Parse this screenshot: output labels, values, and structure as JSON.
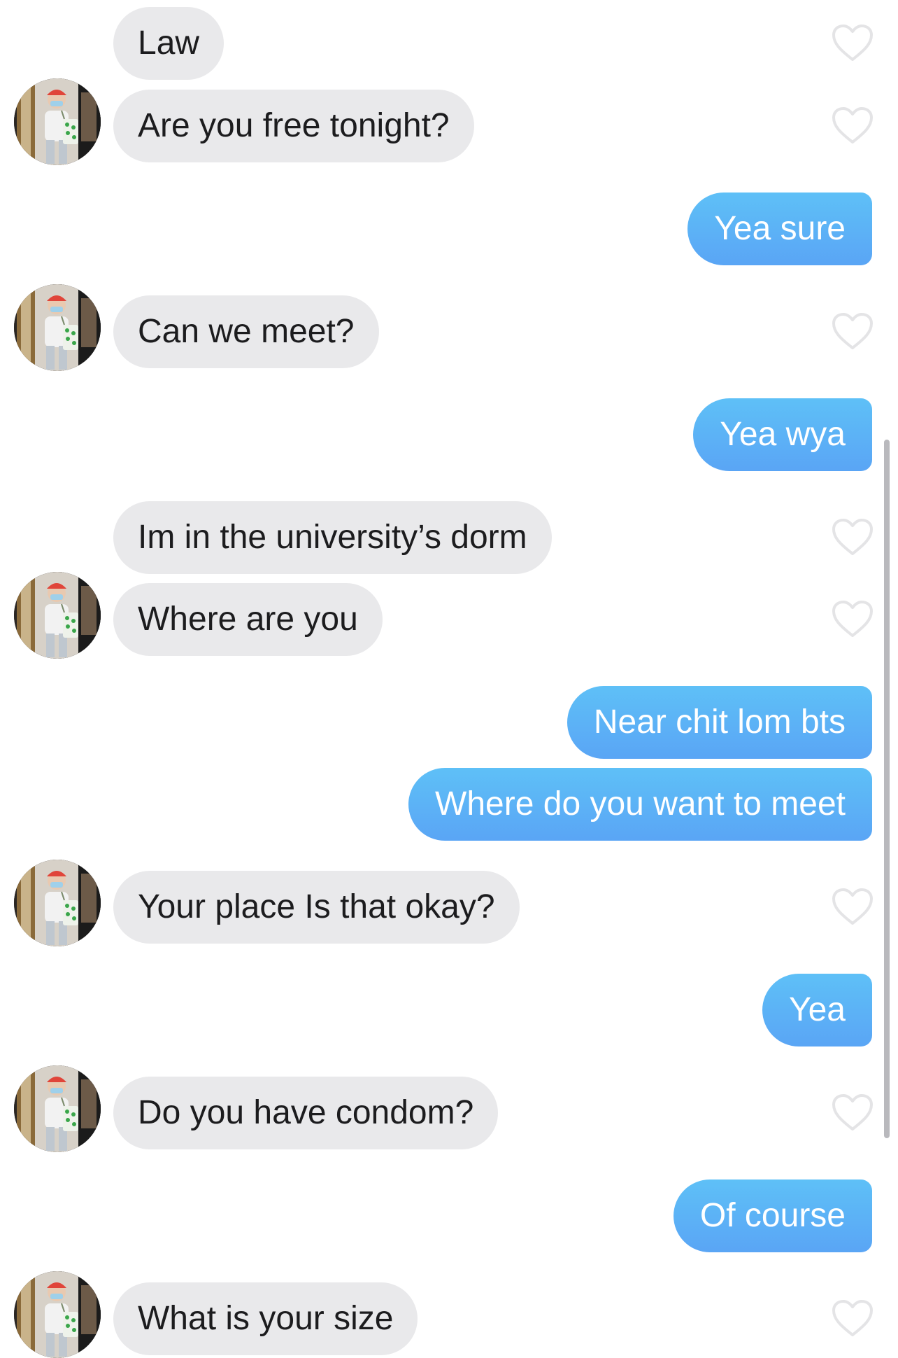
{
  "colors": {
    "incoming_bubble": "#e9e9eb",
    "outgoing_bubble_top": "#5ec0f7",
    "outgoing_bubble_bottom": "#5aa5f5",
    "heart_outline": "#e4e4e6"
  },
  "icons": {
    "like": "heart-outline-icon",
    "avatar": "contact-avatar-photo"
  },
  "messages": [
    {
      "side": "in",
      "text": "Law",
      "avatar": false,
      "liked": false
    },
    {
      "side": "in",
      "text": "Are you free tonight?",
      "avatar": true,
      "liked": false
    },
    {
      "side": "out",
      "text": "Yea sure"
    },
    {
      "side": "in",
      "text": "Can we meet?",
      "avatar": true,
      "liked": false
    },
    {
      "side": "out",
      "text": "Yea wya"
    },
    {
      "side": "in",
      "text": "Im in the university’s dorm",
      "avatar": false,
      "liked": false
    },
    {
      "side": "in",
      "text": "Where are you",
      "avatar": true,
      "liked": false
    },
    {
      "side": "out",
      "text": "Near chit lom bts"
    },
    {
      "side": "out",
      "text": "Where do you want to meet"
    },
    {
      "side": "in",
      "text": "Your place Is that okay?",
      "avatar": true,
      "liked": false
    },
    {
      "side": "out",
      "text": "Yea"
    },
    {
      "side": "in",
      "text": "Do you have condom?",
      "avatar": true,
      "liked": false
    },
    {
      "side": "out",
      "text": "Of course"
    },
    {
      "side": "in",
      "text": "What is your size",
      "avatar": true,
      "liked": false
    }
  ]
}
